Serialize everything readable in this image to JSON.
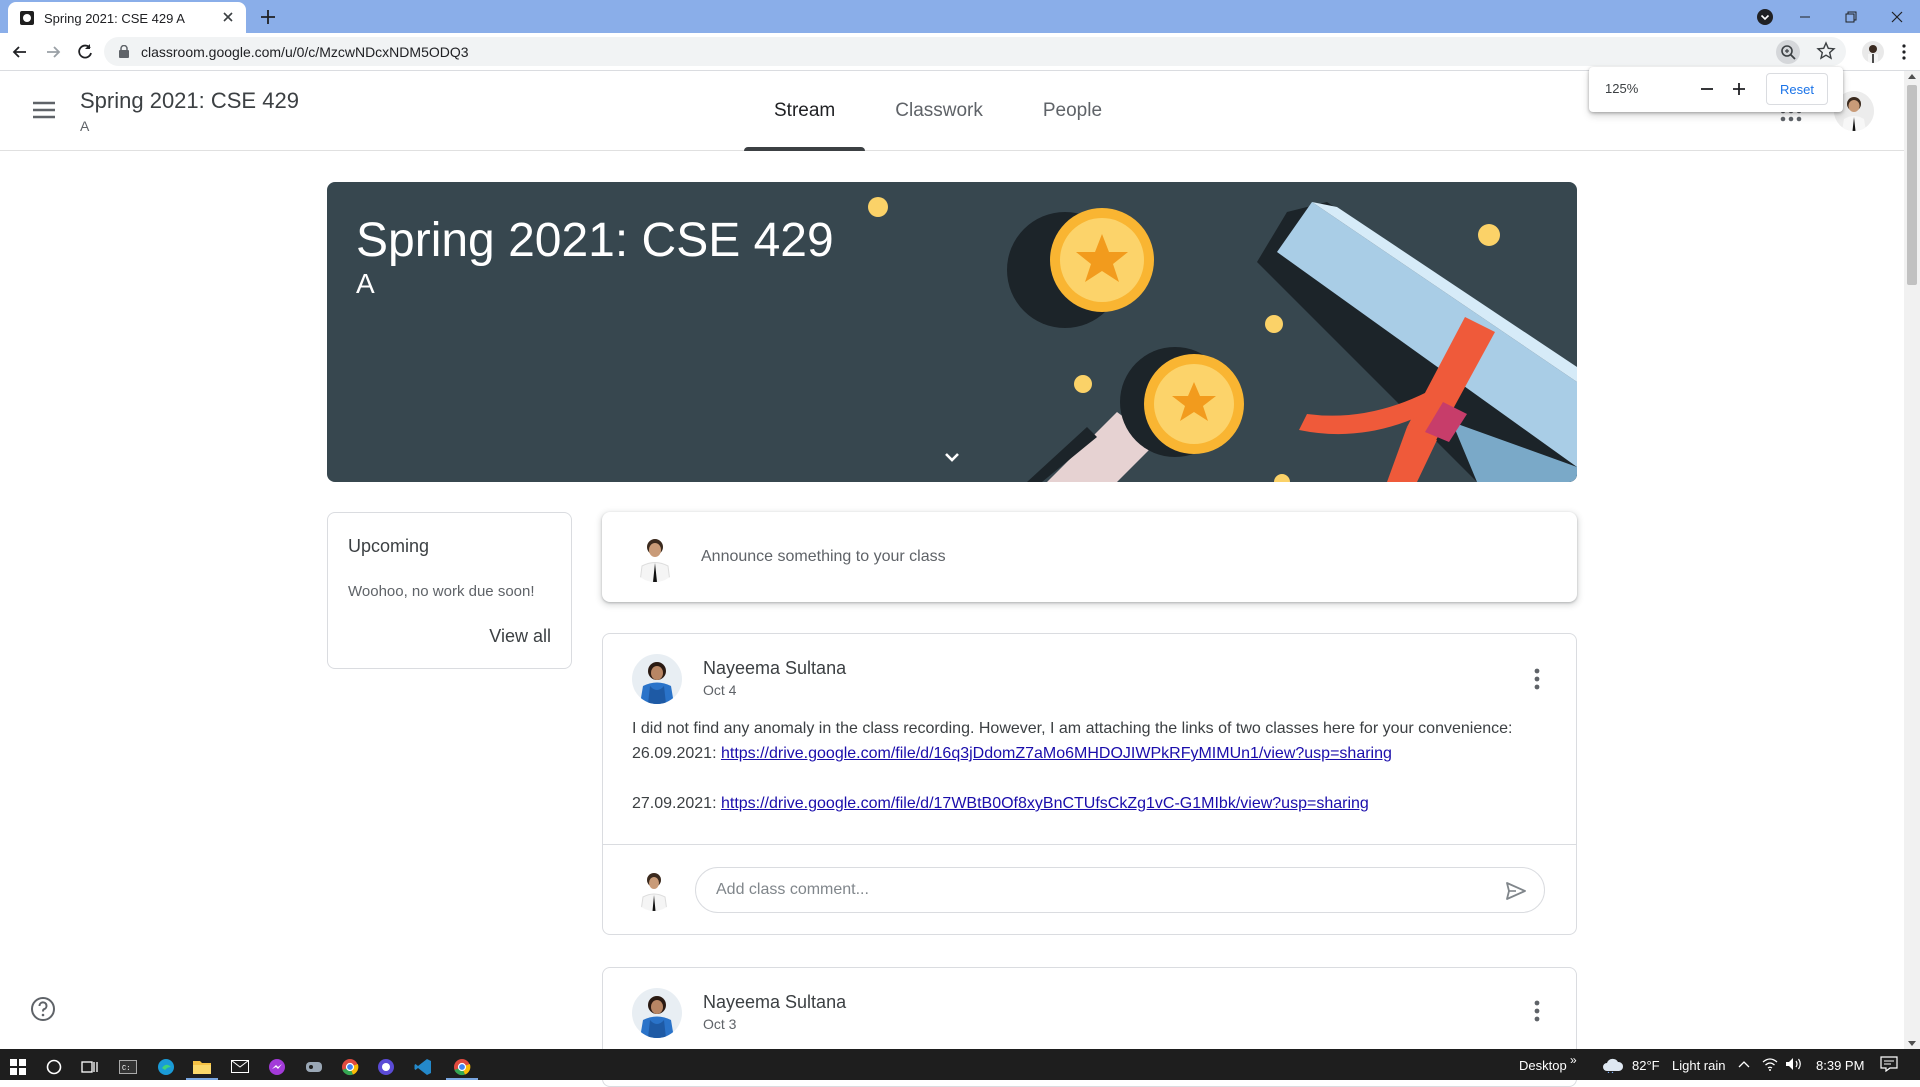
{
  "browser": {
    "tab_title": "Spring 2021: CSE 429 A",
    "url": "classroom.google.com/u/0/c/MzcwNDcxNDM5ODQ3"
  },
  "zoom_popup": {
    "level": "125%",
    "reset_label": "Reset"
  },
  "header": {
    "course_title": "Spring 2021: CSE 429",
    "course_section": "A",
    "tabs": [
      {
        "label": "Stream",
        "active": true
      },
      {
        "label": "Classwork",
        "active": false
      },
      {
        "label": "People",
        "active": false
      }
    ]
  },
  "banner": {
    "title": "Spring 2021: CSE 429",
    "section": "A",
    "background_color": "#37474f"
  },
  "upcoming": {
    "title": "Upcoming",
    "empty_message": "Woohoo, no work due soon!",
    "view_all_label": "View all"
  },
  "announce": {
    "placeholder": "Announce something to your class"
  },
  "posts": [
    {
      "author": "Nayeema Sultana",
      "date": "Oct 4",
      "line1": "I did not find any anomaly in the class recording. However, I am attaching the links of two classes here for your convenience:",
      "date1": "26.09.2021: ",
      "link1": "https://drive.google.com/file/d/16q3jDdomZ7aMo6MHDOJIWPkRFyMIMUn1/view?usp=sharing",
      "date2": "27.09.2021: ",
      "link2": "https://drive.google.com/file/d/17WBtB0Of8xyBnCTUfsCkZg1vC-G1MIbk/view?usp=sharing",
      "comment_placeholder": "Add class comment..."
    },
    {
      "author": "Nayeema Sultana",
      "date": "Oct 3"
    }
  ],
  "taskbar": {
    "desktop_label": "Desktop",
    "temperature": "82°F",
    "weather": "Light rain",
    "time": "8:39 PM"
  },
  "colors": {
    "accent_blue": "#1a73e8",
    "link": "#1a0dab",
    "tab_bar": "#8aaee9"
  }
}
